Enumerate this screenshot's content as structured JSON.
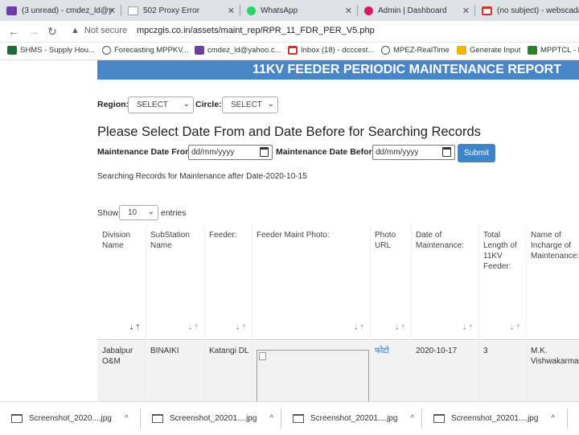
{
  "browser": {
    "tabs": [
      {
        "label": "(3 unread) - cmdez_ld@y",
        "favicon": "mail-icon",
        "color": "#6a3fa0"
      },
      {
        "label": "502 Proxy Error",
        "favicon": "page-icon",
        "color": "#9aa0a6"
      },
      {
        "label": "WhatsApp",
        "favicon": "whatsapp-icon",
        "color": "#25d366"
      },
      {
        "label": "Admin | Dashboard",
        "favicon": "admin-icon",
        "color": "#d81b60"
      },
      {
        "label": "(no subject) - webscada",
        "favicon": "gmail-icon",
        "color": "#d93025"
      }
    ],
    "security_label": "Not secure",
    "url": "mpczgis.co.in/assets/maint_rep/RPR_11_FDR_PER_V5.php",
    "bookmarks": [
      {
        "label": "SHMS - Supply Hou...",
        "icon": "bookmark-icon",
        "color": "#1e6b3b"
      },
      {
        "label": "Forecasting MPPKV...",
        "icon": "globe-icon",
        "color": "#555555"
      },
      {
        "label": "cmdez_ld@yahoo.c...",
        "icon": "mail-icon",
        "color": "#6a3fa0"
      },
      {
        "label": "Inbox (18) - dcccest...",
        "icon": "gmail-icon",
        "color": "#d93025"
      },
      {
        "label": "MPEZ-RealTime",
        "icon": "globe-icon",
        "color": "#555555"
      },
      {
        "label": "Generate Input",
        "icon": "doc-icon",
        "color": "#f4b400"
      },
      {
        "label": "MPPTCL - D",
        "icon": "image-icon",
        "color": "#2e7d32"
      }
    ]
  },
  "report": {
    "banner_title": "11KV FEEDER PERIODIC MAINTENANCE REPORT",
    "region_label": "Region:",
    "region_value": "SELECT",
    "circle_label": "Circle:",
    "circle_value": "SELECT",
    "heading": "Please Select Date From and Date Before for Searching Records",
    "date_from_label": "Maintenance Date From :",
    "date_from_placeholder": "dd/mm/yyyy",
    "date_before_label": "Maintenance Date Before :",
    "date_before_placeholder": "dd/mm/yyyy",
    "submit_label": "Submit",
    "searching_text": "Searching Records for Maintenance after Date-2020-10-15",
    "show_label": "Show",
    "entries_value": "10",
    "entries_label": "entries"
  },
  "table": {
    "headers": [
      "Division Name",
      "SubStation Name",
      "Feeder:",
      "Feeder Maint Photo:",
      "Photo URL",
      "Date of Maintenance:",
      "Total Length of 11KV Feeder:",
      "Name of Incharge of Maintenance:"
    ],
    "rows": [
      {
        "division": "Jabalpur O&M",
        "substation": "BINAIKI",
        "feeder": "Katangi DL",
        "photo_url": "फोटो",
        "date": "2020-10-17",
        "length": "3",
        "incharge": "M.K. Vishwakarma"
      }
    ]
  },
  "downloads": [
    {
      "label": "Screenshot_2020....jpg"
    },
    {
      "label": "Screenshot_20201....jpg"
    },
    {
      "label": "Screenshot_20201....jpg"
    },
    {
      "label": "Screenshot_20201....jpg"
    }
  ]
}
